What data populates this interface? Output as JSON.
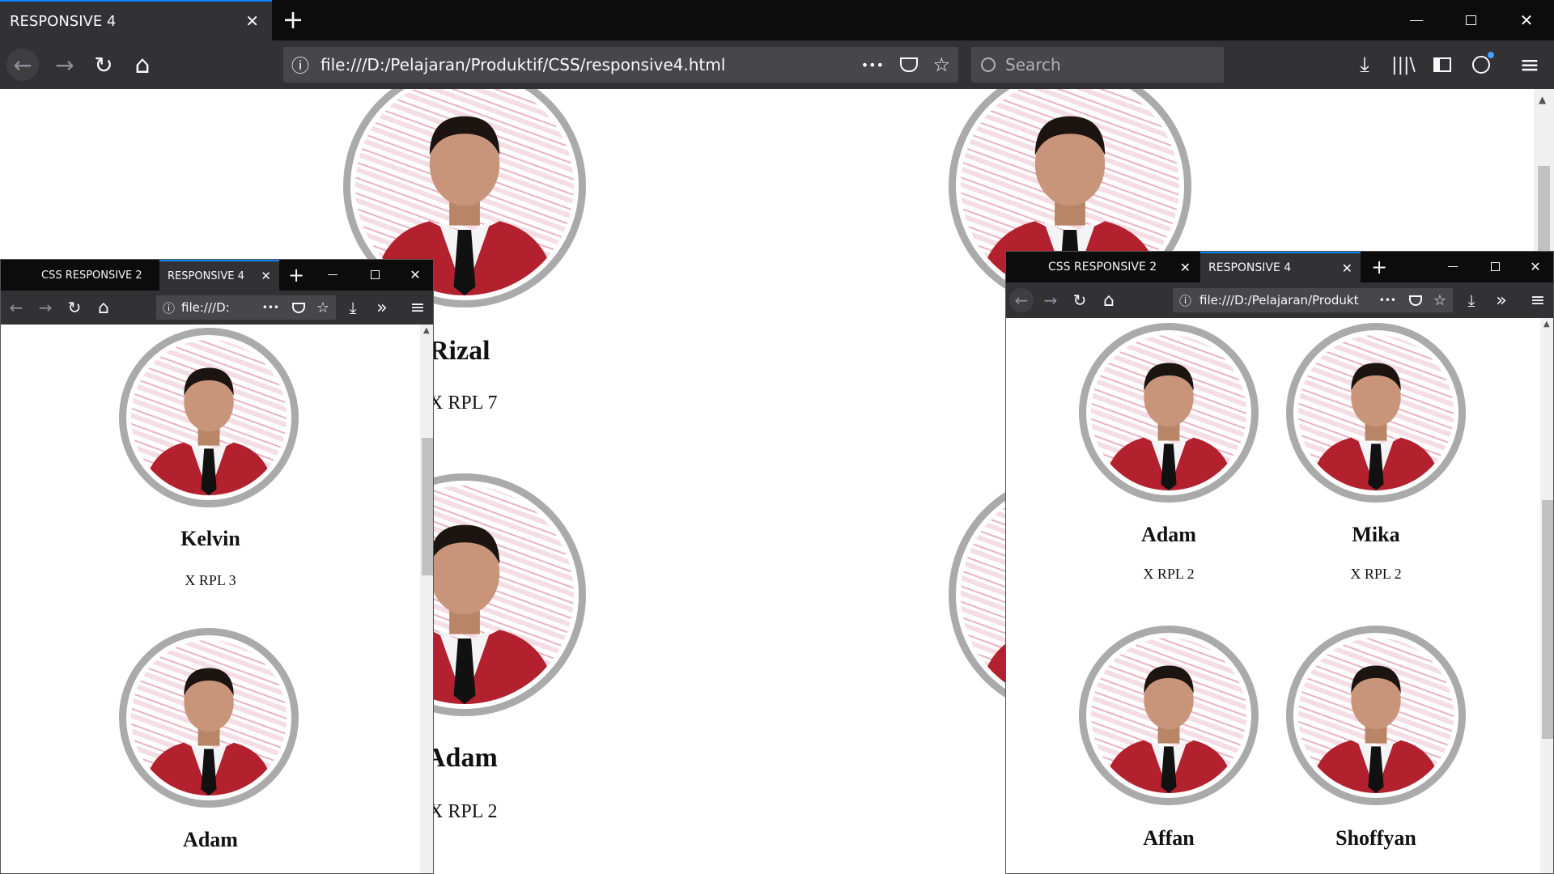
{
  "main_window": {
    "tab_title": "RESPONSIVE 4",
    "url": "file:///D:/Pelajaran/Produktif/CSS/responsive4.html",
    "search_placeholder": "Search",
    "profiles": [
      {
        "name": "Rizal",
        "class": "X RPL 7"
      },
      {
        "name": "Adam",
        "class": "X RPL 2"
      }
    ]
  },
  "left_window": {
    "tabs": [
      {
        "label": "CSS RESPONSIVE 2"
      },
      {
        "label": "RESPONSIVE 4"
      }
    ],
    "url": "file:///D:/",
    "profiles": [
      {
        "name": "Kelvin",
        "class": "X RPL 3"
      },
      {
        "name": "Adam",
        "class": ""
      }
    ]
  },
  "right_window": {
    "tabs": [
      {
        "label": "CSS RESPONSIVE 2"
      },
      {
        "label": "RESPONSIVE 4"
      }
    ],
    "url": "file:///D:/Pelajaran/Produkt",
    "profiles": [
      {
        "name": "Adam",
        "class": "X RPL 2"
      },
      {
        "name": "Mika",
        "class": "X RPL 2"
      },
      {
        "name": "Affan",
        "class": ""
      },
      {
        "name": "Shoffyan",
        "class": ""
      }
    ]
  },
  "icons": {
    "close": "✕",
    "plus": "+",
    "back": "←",
    "forward": "→",
    "reload": "↻",
    "home": "⌂",
    "info": "ⓘ",
    "more": "•••",
    "star": "☆",
    "download": "⤓",
    "menu": "≡",
    "overflow": "»",
    "minimize": "—",
    "maximize": "☐"
  },
  "colors": {
    "accent": "#0a84ff",
    "chrome_dark": "#0c0c0d",
    "toolbar": "#323234",
    "ring": "#aaaaaa",
    "blazer": "#b3202e"
  }
}
